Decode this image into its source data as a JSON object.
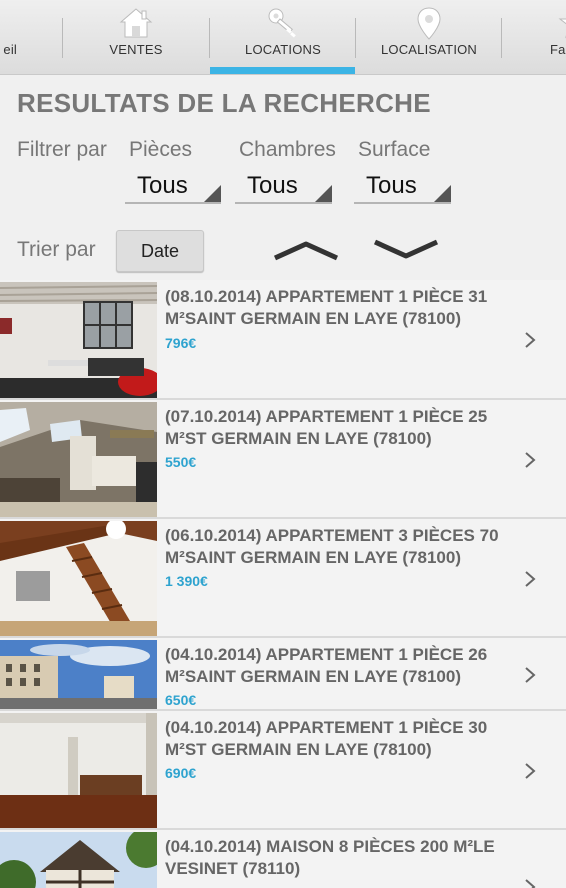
{
  "nav": {
    "partial_left": "eil",
    "ventes": "VENTES",
    "locations": "LOCATIONS",
    "localisation": "LOCALISATION",
    "partial_right": "Fa"
  },
  "title": "RESULTATS DE LA RECHERCHE",
  "filters": {
    "label": "Filtrer par",
    "pieces": {
      "label": "Pièces",
      "value": "Tous"
    },
    "chambres": {
      "label": "Chambres",
      "value": "Tous"
    },
    "surface": {
      "label": "Surface",
      "value": "Tous"
    }
  },
  "sort": {
    "label": "Trier par",
    "button": "Date"
  },
  "listings": [
    {
      "title": "(08.10.2014) APPARTEMENT 1 PIÈCE 31 M²SAINT GERMAIN EN LAYE (78100)",
      "price": "796€"
    },
    {
      "title": "(07.10.2014) APPARTEMENT 1 PIÈCE 25 M²ST GERMAIN EN LAYE (78100)",
      "price": "550€"
    },
    {
      "title": "(06.10.2014) APPARTEMENT 3 PIÈCES 70 M²SAINT GERMAIN EN LAYE (78100)",
      "price": "1 390€"
    },
    {
      "title": "(04.10.2014) APPARTEMENT 1 PIÈCE 26 M²SAINT GERMAIN EN LAYE (78100)",
      "price": "650€"
    },
    {
      "title": "(04.10.2014) APPARTEMENT 1 PIÈCE 30 M²ST GERMAIN EN LAYE (78100)",
      "price": "690€"
    },
    {
      "title": "(04.10.2014) MAISON 8 PIÈCES 200 M²LE VESINET (78110)",
      "price": ""
    }
  ],
  "colors": {
    "accent": "#3cb4e5",
    "price": "#2ea3cf"
  }
}
